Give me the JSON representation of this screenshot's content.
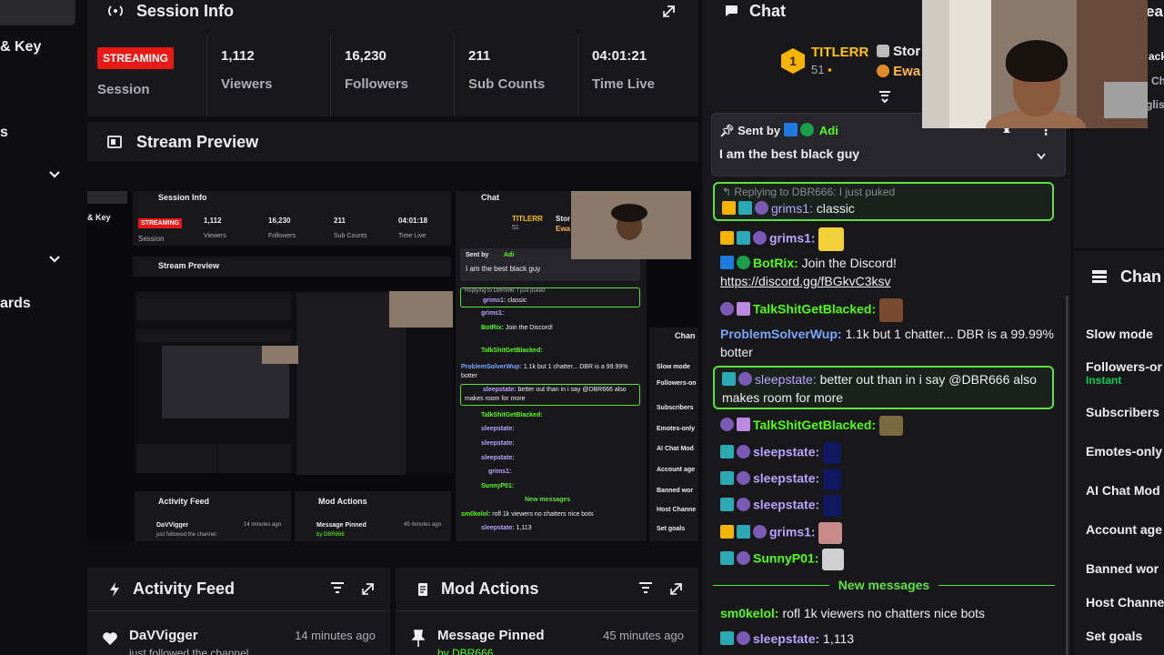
{
  "left_nav": {
    "items": [
      {
        "label": "& Key"
      },
      {
        "label": "s"
      },
      {
        "label": "ards"
      }
    ]
  },
  "session_info": {
    "title": "Session Info",
    "status_badge": "STREAMING",
    "session_label": "Session",
    "stats": [
      {
        "value": "1,112",
        "label": "Viewers"
      },
      {
        "value": "16,230",
        "label": "Followers"
      },
      {
        "value": "211",
        "label": "Sub Counts"
      },
      {
        "value": "04:01:21",
        "label": "Time Live"
      }
    ]
  },
  "stream_preview": {
    "title": "Stream Preview",
    "mini": {
      "session_title": "Session Info",
      "nav_label": "& Key",
      "status": "STREAMING",
      "session_label": "Session",
      "stats": [
        {
          "value": "1,112",
          "label": "Viewers"
        },
        {
          "value": "16,230",
          "label": "Followers"
        },
        {
          "value": "211",
          "label": "Sub Counts"
        },
        {
          "value": "04:01:18",
          "label": "Time Live"
        }
      ],
      "preview_title": "Stream Preview",
      "chat_title": "Chat",
      "leader": "TITLERR",
      "leader_count": "51",
      "leader_trunc": "Stor",
      "leader_trunc2": "Ewa",
      "pinned_by": "Sent by",
      "pinned_user": "Adi",
      "pinned_text": "I am the best black guy",
      "reply": "Replying to DBR666: I just puked",
      "messages": [
        {
          "user": "grims1:",
          "text": "classic"
        },
        {
          "user": "grims1:",
          "text": ""
        },
        {
          "user": "BotRix:",
          "text": "Join the Discord!"
        },
        {
          "user": "TalkShitGetBlacked:",
          "text": ""
        },
        {
          "user": "ProblemSolverWup:",
          "text": "1.1k but 1 chatter... DBR is a 99.99%"
        },
        {
          "user": "",
          "text": "botter"
        },
        {
          "user": "sleepstate:",
          "text": "better out than in i say @DBR666 also"
        },
        {
          "user": "",
          "text": "makes room for more"
        },
        {
          "user": "TalkShitGetBlacked:",
          "text": ""
        },
        {
          "user": "sleepstate:",
          "text": ""
        },
        {
          "user": "sleepstate:",
          "text": ""
        },
        {
          "user": "sleepstate:",
          "text": ""
        },
        {
          "user": "grims1:",
          "text": ""
        },
        {
          "user": "SunnyP01:",
          "text": ""
        }
      ],
      "new_messages": "New messages",
      "last_msgs": [
        {
          "user": "sm0kelol:",
          "text": "rofl 1k viewers no chatters nice bots"
        },
        {
          "user": "sleepstate:",
          "text": "1,113"
        }
      ],
      "side_title": "Chan",
      "side_items": [
        "Slow mode",
        "Followers-on",
        "Subscribers",
        "Emotes-only",
        "AI Chat Mod",
        "Account age",
        "Banned wor",
        "Host Channe",
        "Set goals"
      ],
      "activity_title": "Activity Feed",
      "activity_user": "DaVVigger",
      "activity_sub": "just followed the channel",
      "activity_time": "14 minutes ago",
      "mod_title": "Mod Actions",
      "mod_item": "Message Pinned",
      "mod_by": "by DBR666",
      "mod_time": "45 minutes ago"
    }
  },
  "activity_feed": {
    "title": "Activity Feed",
    "item": {
      "user": "DaVVigger",
      "sub": "just followed the channel",
      "time": "14 minutes ago"
    }
  },
  "mod_actions": {
    "title": "Mod Actions",
    "item": {
      "title": "Message Pinned",
      "by": "by DBR666",
      "time": "45 minutes ago"
    }
  },
  "chat": {
    "title": "Chat",
    "leader": {
      "name": "TITLERR",
      "count": "51"
    },
    "leader_trunc": [
      "Stor",
      "Ewa"
    ],
    "pinned": {
      "label": "Sent by",
      "user": "Adi",
      "text": "I am the best black guy"
    },
    "reply_to": "Replying to DBR666: I just puked",
    "messages": [
      {
        "user": "grims1:",
        "text": "classic",
        "color": "#b9a3ff"
      },
      {
        "user": "grims1:",
        "text": "",
        "color": "#b9a3ff"
      },
      {
        "user": "BotRix:",
        "text": "Join the Discord!",
        "color": "#53fc18"
      },
      {
        "link": "https://discord.gg/fBGkvC3ksv"
      },
      {
        "user": "TalkShitGetBlacked:",
        "text": "",
        "color": "#53fc18"
      },
      {
        "user": "ProblemSolverWup:",
        "text": "1.1k but 1 chatter... DBR is a 99.99%",
        "cont": "botter",
        "color": "#7aa6ff"
      },
      {
        "user": "sleepstate:",
        "text": "better out than in i say @DBR666 also",
        "cont": "makes room for more",
        "color": "#b9a3ff"
      },
      {
        "user": "TalkShitGetBlacked:",
        "text": "",
        "color": "#53fc18"
      },
      {
        "user": "sleepstate:",
        "text": "",
        "color": "#b9a3ff"
      },
      {
        "user": "sleepstate:",
        "text": "",
        "color": "#b9a3ff"
      },
      {
        "user": "sleepstate:",
        "text": "",
        "color": "#b9a3ff"
      },
      {
        "user": "grims1:",
        "text": "",
        "color": "#b9a3ff"
      },
      {
        "user": "SunnyP01:",
        "text": "",
        "color": "#53fc18"
      }
    ],
    "new_messages": "New messages",
    "after_new": [
      {
        "user": "sm0kelol:",
        "text": "rofl 1k viewers no chatters nice bots",
        "color": "#53fc18"
      },
      {
        "user": "sleepstate:",
        "text": "1,113",
        "color": "#b9a3ff"
      }
    ]
  },
  "right_panel": {
    "top_trunc": [
      "ea",
      "ack",
      "Ch",
      "glis"
    ],
    "title": "Chan",
    "items": [
      "Slow mode",
      "Followers-or",
      "Subscribers",
      "Emotes-only",
      "AI Chat Mod",
      "Account age",
      "Banned wor",
      "Host Channe",
      "Set goals"
    ],
    "followers_sub": "Instant"
  },
  "colors": {
    "accent_green": "#53fc18",
    "highlight_border": "#60e040",
    "live_red": "#e91916",
    "panel_bg": "#18181b",
    "page_bg": "#0e0e10"
  }
}
